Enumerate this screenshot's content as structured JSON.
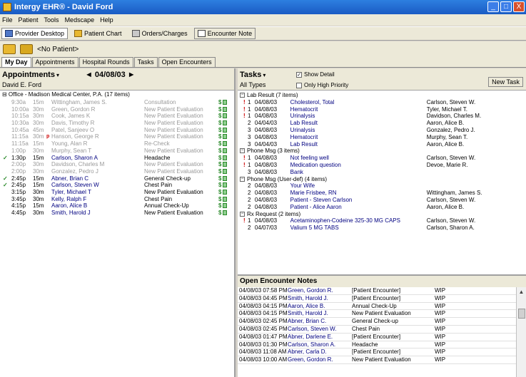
{
  "window": {
    "title": "Intergy EHR® - David Ford",
    "min": "_",
    "max": "□",
    "close": "X"
  },
  "menu": [
    "File",
    "Patient",
    "Tools",
    "Medscape",
    "Help"
  ],
  "toolbar": [
    "Provider Desktop",
    "Patient Chart",
    "Orders/Charges",
    "Encounter Note"
  ],
  "patient": {
    "label": "<No Patient>"
  },
  "tabs": [
    "My Day",
    "Appointments",
    "Hospital Rounds",
    "Tasks",
    "Open Encounters"
  ],
  "appointments": {
    "title": "Appointments",
    "date": "◄ 04/08/03 ►",
    "provider": "David E. Ford",
    "office": "⊟ Office - Madison Medical Center, P.A. (17 items)",
    "rows": [
      {
        "time": "9:30a",
        "dur": "15m",
        "patient": "Wittingham, James S.",
        "reason": "Consultation",
        "state": "past"
      },
      {
        "time": "10:00a",
        "dur": "30m",
        "patient": "Green, Gordon R",
        "reason": "New Patient Evaluation",
        "state": "past"
      },
      {
        "time": "10:15a",
        "dur": "30m",
        "patient": "Cook, James K",
        "reason": "New Patient Evaluation",
        "state": "past"
      },
      {
        "time": "10:30a",
        "dur": "30m",
        "patient": "Davis, Timothy R",
        "reason": "New Patient Evaluation",
        "state": "past"
      },
      {
        "time": "10:45a",
        "dur": "45m",
        "patient": "Patel, Sanjeev O",
        "reason": "New Patient Evaluation",
        "state": "past"
      },
      {
        "time": "11:15a",
        "dur": "30m",
        "patient": "Hanson, George R",
        "reason": "New Patient Evaluation",
        "state": "past",
        "flag": "p"
      },
      {
        "time": "11:15a",
        "dur": "15m",
        "patient": "Young, Alan R",
        "reason": "Re-Check",
        "state": "past"
      },
      {
        "time": "1:00p",
        "dur": "30m",
        "patient": "Murphy, Sean T",
        "reason": "New Patient Evaluation",
        "state": "past"
      },
      {
        "time": "1:30p",
        "dur": "15m",
        "patient": "Carlson, Sharon A",
        "reason": "Headache",
        "state": "cur",
        "check": "✓"
      },
      {
        "time": "2:00p",
        "dur": "30m",
        "patient": "Davidson, Charles M",
        "reason": "New Patient Evaluation",
        "state": "past"
      },
      {
        "time": "2:00p",
        "dur": "30m",
        "patient": "Gonzalez, Pedro J",
        "reason": "New Patient Evaluation",
        "state": "past"
      },
      {
        "time": "2:45p",
        "dur": "15m",
        "patient": "Abner, Brian C",
        "reason": "General Check-up",
        "state": "cur",
        "check": "✓"
      },
      {
        "time": "2:45p",
        "dur": "15m",
        "patient": "Carlson, Steven W",
        "reason": "Chest Pain",
        "state": "cur",
        "check": "✓"
      },
      {
        "time": "3:15p",
        "dur": "30m",
        "patient": "Tyler, Michael T",
        "reason": "New Patient Evaluation",
        "state": "cur"
      },
      {
        "time": "3:45p",
        "dur": "30m",
        "patient": "Kelly, Ralph F",
        "reason": "Chest Pain",
        "state": "cur"
      },
      {
        "time": "4:15p",
        "dur": "15m",
        "patient": "Aaron, Alice B",
        "reason": "Annual Check-Up",
        "state": "cur"
      },
      {
        "time": "4:45p",
        "dur": "30m",
        "patient": "Smith, Harold J",
        "reason": "New Patient Evaluation",
        "state": "cur"
      }
    ]
  },
  "tasks": {
    "title": "Tasks",
    "show_detail": "Show Detail",
    "only_high": "Only High Priority",
    "all_types": "All Types",
    "new_task": "New Task",
    "groups": [
      {
        "label": "Lab Result (7 items)",
        "rows": [
          {
            "ex": "!",
            "p": "1",
            "date": "04/08/03",
            "desc": "Cholesterol, Total",
            "name": "Carlson, Steven W."
          },
          {
            "ex": "!",
            "p": "1",
            "date": "04/08/03",
            "desc": "Hematocrit",
            "name": "Tyler, Michael T."
          },
          {
            "ex": "!",
            "p": "1",
            "date": "04/08/03",
            "desc": "Urinalysis",
            "name": "Davidson, Charles M."
          },
          {
            "ex": "",
            "p": "2",
            "date": "04/04/03",
            "desc": "Lab Result",
            "name": "Aaron, Alice B."
          },
          {
            "ex": "",
            "p": "3",
            "date": "04/08/03",
            "desc": "Urinalysis",
            "name": "Gonzalez, Pedro J."
          },
          {
            "ex": "",
            "p": "3",
            "date": "04/08/03",
            "desc": "Hematocrit",
            "name": "Murphy, Sean T."
          },
          {
            "ex": "",
            "p": "3",
            "date": "04/04/03",
            "desc": "Lab Result",
            "name": "Aaron, Alice B."
          }
        ]
      },
      {
        "label": "Phone Msg (3 items)",
        "rows": [
          {
            "ex": "!",
            "p": "1",
            "date": "04/08/03",
            "desc": "Not feeling well",
            "name": "Carlson, Steven W."
          },
          {
            "ex": "!",
            "p": "1",
            "date": "04/08/03",
            "desc": "Medication question",
            "name": "Devoe, Marie R."
          },
          {
            "ex": "",
            "p": "3",
            "date": "04/08/03",
            "desc": "Bank",
            "name": ""
          }
        ]
      },
      {
        "label": "Phone Msg (User-def) (4 items)",
        "rows": [
          {
            "ex": "",
            "p": "2",
            "date": "04/08/03",
            "desc": "Your Wife",
            "name": ""
          },
          {
            "ex": "",
            "p": "2",
            "date": "04/08/03",
            "desc": "Marie Frisbee, RN",
            "name": "Wittingham, James S."
          },
          {
            "ex": "",
            "p": "2",
            "date": "04/08/03",
            "desc": "Patient - Steven Carlson",
            "name": "Carlson, Steven W."
          },
          {
            "ex": "",
            "p": "2",
            "date": "04/08/03",
            "desc": "Patient - Alice Aaron",
            "name": "Aaron, Alice B."
          }
        ]
      },
      {
        "label": "Rx Request (2 items)",
        "rows": [
          {
            "ex": "!",
            "p": "1",
            "date": "04/08/03",
            "desc": "Acetaminophen-Codeine 325-30 MG CAPS",
            "name": "Carlson, Steven W."
          },
          {
            "ex": "",
            "p": "2",
            "date": "04/07/03",
            "desc": "Valium 5 MG TABS",
            "name": "Carlson, Sharon A."
          }
        ]
      }
    ]
  },
  "encounters": {
    "title": "Open Encounter Notes",
    "rows": [
      {
        "date": "04/08/03 07:58 PM",
        "name": "Green, Gordon R.",
        "type": "[Patient Encounter]",
        "status": "WIP"
      },
      {
        "date": "04/08/03 04:45 PM",
        "name": "Smith, Harold J.",
        "type": "[Patient Encounter]",
        "status": "WIP"
      },
      {
        "date": "04/08/03 04:15 PM",
        "name": "Aaron, Alice B.",
        "type": "Annual Check-Up",
        "status": "WIP"
      },
      {
        "date": "04/08/03 04:15 PM",
        "name": "Smith, Harold J.",
        "type": "New Patient Evaluation",
        "status": "WIP"
      },
      {
        "date": "04/08/03 02:45 PM",
        "name": "Abner, Brian C.",
        "type": "General Check-up",
        "status": "WIP"
      },
      {
        "date": "04/08/03 02:45 PM",
        "name": "Carlson, Steven W.",
        "type": "Chest Pain",
        "status": "WIP"
      },
      {
        "date": "04/08/03 01:47 PM",
        "name": "Abner, Darlene E.",
        "type": "[Patient Encounter]",
        "status": "WIP"
      },
      {
        "date": "04/08/03 01:30 PM",
        "name": "Carlson, Sharon A.",
        "type": "Headache",
        "status": "WIP"
      },
      {
        "date": "04/08/03 11:08 AM",
        "name": "Abner, Carla D.",
        "type": "[Patient Encounter]",
        "status": "WIP"
      },
      {
        "date": "04/08/03 10:00 AM",
        "name": "Green, Gordon R.",
        "type": "New Patient Evaluation",
        "status": "WIP"
      }
    ]
  },
  "colors": {
    "title_bar": "#1a5bc4",
    "link": "#000080",
    "alert": "#cc0000",
    "check": "#2a8a2a"
  }
}
